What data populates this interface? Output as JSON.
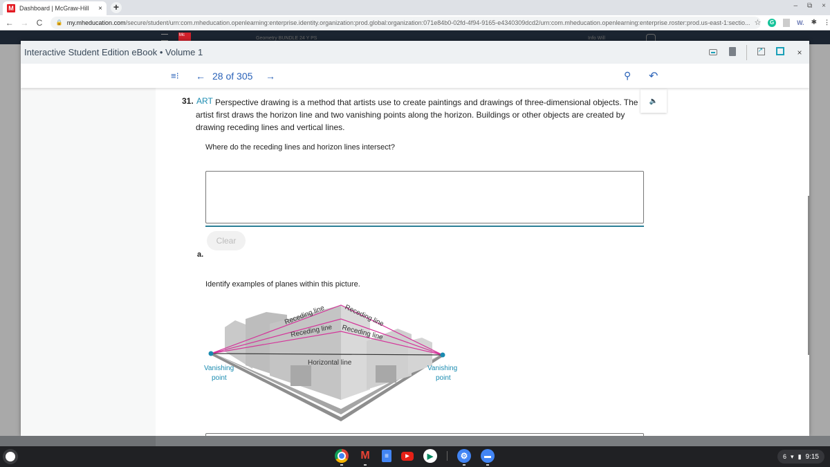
{
  "browser": {
    "tab": {
      "title": "Dashboard | McGraw-Hill",
      "favicon": "M",
      "close": "×"
    },
    "new_tab": "+",
    "window_controls": {
      "minimize": "–",
      "restore": "⧉",
      "close": "×"
    },
    "nav": {
      "back": "←",
      "forward": "→",
      "reload": "C"
    },
    "url": {
      "host": "my.mheducation.com",
      "path": "/secure/student/urn:com.mheducation.openlearning:enterprise.identity.organization:prod.global:organization:071e84b0-02fd-4f94-9165-e4340309dcd2/urn:com.mheducation.openlearning:enterprise.roster:prod.us-east-1:sectio..."
    },
    "bookmark_icon": "☆",
    "extensions": {
      "grammarly": "G",
      "w": "W.",
      "puzzle": "✱",
      "menu": "⋮"
    }
  },
  "app_header": {
    "logo": "Mc",
    "faded_center": "Geometry BUNDLE 24 Y PS",
    "faded_right": "Info Will"
  },
  "modal": {
    "title": "Interactive Student Edition eBook • Volume 1",
    "tools": {
      "close": "×"
    }
  },
  "reader_nav": {
    "toc_icon": "≡⁝",
    "prev": "←",
    "page_count": "28 of 305",
    "next": "→",
    "search": "⚲",
    "back": "↶"
  },
  "question": {
    "number": "31.",
    "tag": "ART",
    "text": "Perspective drawing is a method that artists use to create paintings and drawings of three-dimensional objects. The artist first draws the horizon line and two vanishing points along the horizon. Buildings or other objects are created by drawing receding lines and vertical lines.",
    "audio_icon": "🔈",
    "sub_question": "Where do the receding lines and horizon lines intersect?",
    "answer_value": "",
    "clear_label": "Clear",
    "part_label": "a.",
    "sub_question_2": "Identify examples of planes within this picture."
  },
  "figure": {
    "labels": {
      "receding_1": "Receding line",
      "receding_2": "Receding line",
      "receding_3": "Receding line",
      "receding_4": "Receding line",
      "horizontal": "Horizontal line",
      "vp_left_1": "Vanishing",
      "vp_left_2": "point",
      "vp_right_1": "Vanishing",
      "vp_right_2": "point"
    },
    "colors": {
      "receding": "#d4359a",
      "vanishing": "#1a8bb0",
      "horizontal": "#333333"
    }
  },
  "shelf": {
    "apps": [
      "Chrome",
      "Gmail",
      "Docs",
      "YouTube",
      "Play Store",
      "Settings",
      "Files"
    ],
    "tray": {
      "notifications": "6",
      "wifi": "▾",
      "battery": "▮",
      "time": "9:15"
    }
  }
}
